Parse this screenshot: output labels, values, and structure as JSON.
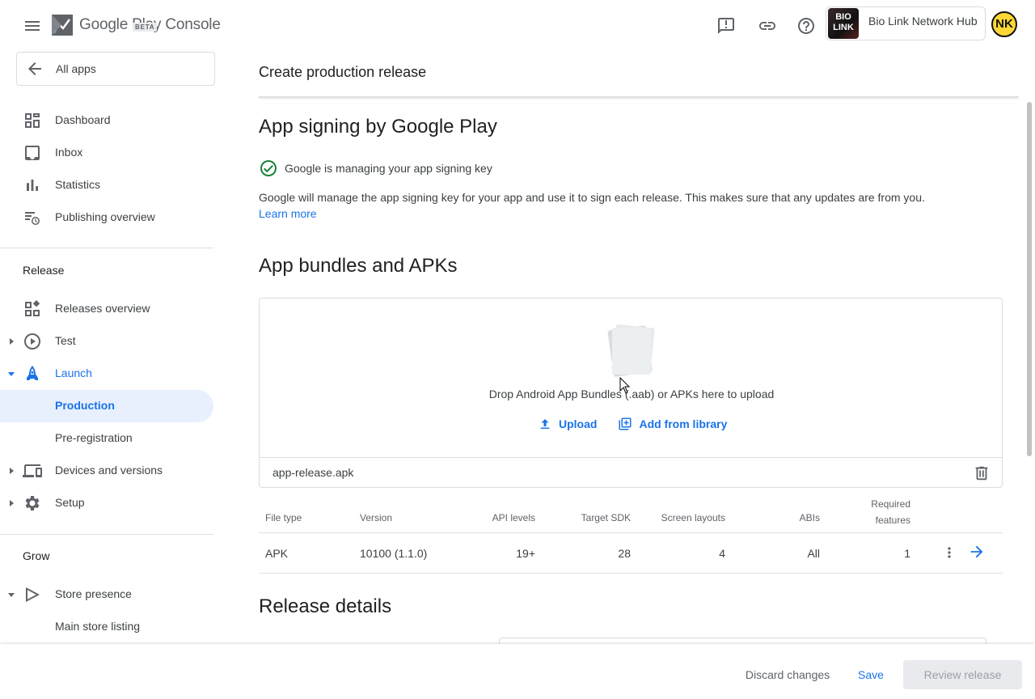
{
  "header": {
    "logo_text": "Google Play Console",
    "beta_label": "BETA",
    "icons": [
      "feedback-icon",
      "link-icon",
      "help-icon"
    ],
    "account_logo_text": "BIO LINK",
    "account_name": "Bio Link Network Hub",
    "avatar_initials": "NK"
  },
  "sidebar": {
    "all_apps": "All apps",
    "top_items": [
      {
        "label": "Dashboard",
        "icon": "dashboard-icon"
      },
      {
        "label": "Inbox",
        "icon": "inbox-icon"
      },
      {
        "label": "Statistics",
        "icon": "statistics-icon"
      },
      {
        "label": "Publishing overview",
        "icon": "publishing-overview-icon"
      }
    ],
    "release_title": "Release",
    "release_items": [
      {
        "label": "Releases overview",
        "icon": "releases-overview-icon"
      },
      {
        "label": "Test",
        "icon": "test-icon"
      },
      {
        "label": "Launch",
        "icon": "launch-icon"
      },
      {
        "label": "Production"
      },
      {
        "label": "Pre-registration"
      },
      {
        "label": "Devices and versions",
        "icon": "devices-icon"
      },
      {
        "label": "Setup",
        "icon": "settings-icon"
      }
    ],
    "grow_title": "Grow",
    "grow_items": [
      {
        "label": "Store presence",
        "icon": "store-presence-icon"
      },
      {
        "label": "Main store listing"
      }
    ]
  },
  "main": {
    "page_title": "Create production release",
    "signing": {
      "heading": "App signing by Google Play",
      "status": "Google is managing your app signing key",
      "description": "Google will manage the app signing key for your app and use it to sign each release. This makes sure that any updates are from you.",
      "learn_more": "Learn more"
    },
    "bundles": {
      "heading": "App bundles and APKs",
      "drop_text": "Drop Android App Bundles (.aab) or APKs here to upload",
      "upload_label": "Upload",
      "library_label": "Add from library",
      "file_name": "app-release.apk"
    },
    "table": {
      "headers": [
        "File type",
        "Version",
        "API levels",
        "Target SDK",
        "Screen layouts",
        "ABIs",
        "Required features"
      ],
      "required_line1": "Required",
      "required_line2": "features",
      "row": {
        "file_type": "APK",
        "version": "10100 (1.1.0)",
        "api_levels": "19+",
        "target_sdk": "28",
        "screen_layouts": "4",
        "abis": "All",
        "required_features": "1"
      }
    },
    "release_details_heading": "Release details"
  },
  "footer": {
    "discard": "Discard changes",
    "save": "Save",
    "review": "Review release"
  },
  "colors": {
    "accent": "#1a73e8",
    "active_bg": "#e8f0fe",
    "success": "#188038",
    "avatar_bg": "#fdd835"
  }
}
